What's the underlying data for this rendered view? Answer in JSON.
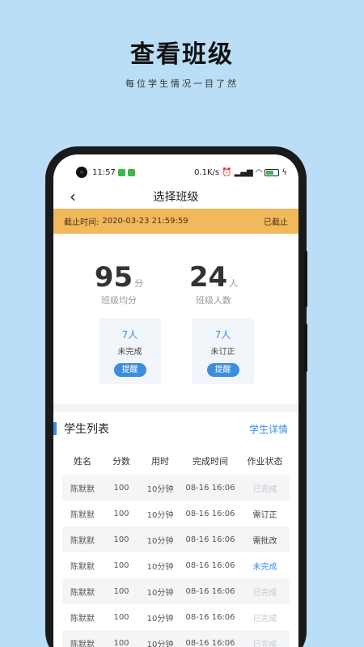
{
  "promo": {
    "title": "查看班级",
    "subtitle": "每位学生情况一目了然"
  },
  "status_bar": {
    "time": "11:57",
    "network": "0.1K/s",
    "signal_text": "ᵂᴵᶠᴵ"
  },
  "nav": {
    "title": "选择班级",
    "back_icon": "chevron-left-icon"
  },
  "deadline": {
    "label": "截止时间:",
    "datetime": "2020-03-23 21:59:59",
    "status": "已截止"
  },
  "stats": {
    "avg_score": "95",
    "avg_unit": "分",
    "avg_label": "班级均分",
    "class_size": "24",
    "size_unit": "人",
    "size_label": "班级人数"
  },
  "cards": [
    {
      "count": "7人",
      "label": "未完成",
      "button": "提醒"
    },
    {
      "count": "7人",
      "label": "未订正",
      "button": "提醒"
    }
  ],
  "student_list": {
    "title": "学生列表",
    "detail_link": "学生详情",
    "columns": [
      "姓名",
      "分数",
      "用时",
      "完成时间",
      "作业状态"
    ],
    "rows": [
      {
        "name": "陈默默",
        "score": "100",
        "time": "10分钟",
        "finished": "08-16 16:06",
        "status": "已完成",
        "status_type": "done"
      },
      {
        "name": "陈默默",
        "score": "100",
        "time": "10分钟",
        "finished": "08-16 16:06",
        "status": "需订正",
        "status_type": "fix"
      },
      {
        "name": "陈默默",
        "score": "100",
        "time": "10分钟",
        "finished": "08-16 16:06",
        "status": "需批改",
        "status_type": "grade"
      },
      {
        "name": "陈默默",
        "score": "100",
        "time": "10分钟",
        "finished": "08-16 16:06",
        "status": "未完成",
        "status_type": "todo"
      },
      {
        "name": "陈默默",
        "score": "100",
        "time": "10分钟",
        "finished": "08-16 16:06",
        "status": "已完成",
        "status_type": "done"
      },
      {
        "name": "陈默默",
        "score": "100",
        "time": "10分钟",
        "finished": "08-16 16:06",
        "status": "已完成",
        "status_type": "done"
      },
      {
        "name": "陈默默",
        "score": "100",
        "time": "10分钟",
        "finished": "08-16 16:06",
        "status": "已完成",
        "status_type": "done"
      }
    ]
  },
  "colors": {
    "background": "#b9def5",
    "accent": "#3b8de0",
    "deadline_bar": "#f2b95c"
  }
}
